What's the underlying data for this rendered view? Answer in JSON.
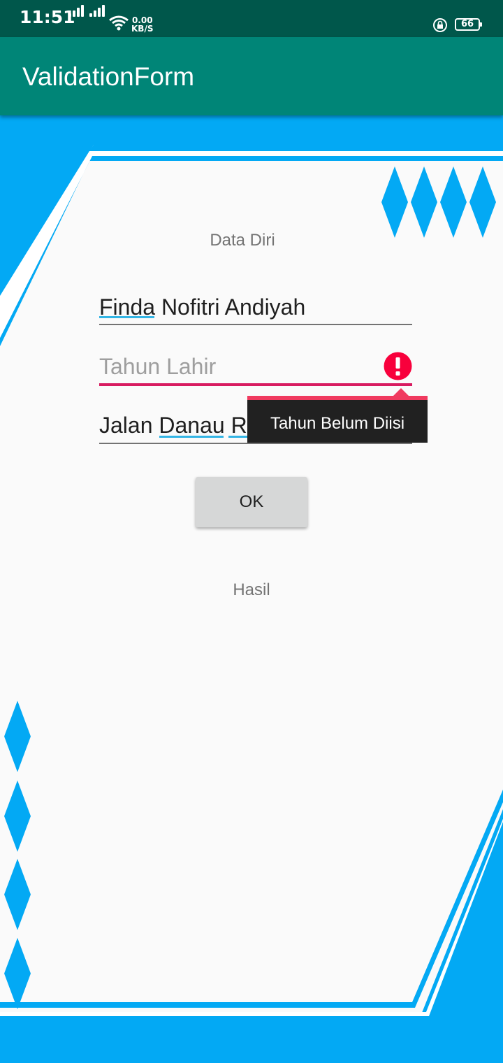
{
  "status_bar": {
    "time": "11:51",
    "net_speed_value": "0.00",
    "net_speed_unit": "KB/S",
    "battery_level": "66",
    "icons": [
      "signal-icon",
      "signal-icon",
      "wifi-icon",
      "lock-rotation-icon",
      "battery-icon"
    ]
  },
  "app_bar": {
    "title": "ValidationForm"
  },
  "form": {
    "header": "Data Diri",
    "nama_value": "Finda Nofitri Andiyah",
    "tahun_placeholder": "Tahun Lahir",
    "alamat_value": "Jalan Danau Ranau G1D8",
    "error_tooltip": "Tahun Belum Diisi",
    "ok_label": "OK",
    "result_label": "Hasil"
  },
  "colors": {
    "status_bar": "#00574B",
    "app_bar": "#008577",
    "decoration": "#03A9F4",
    "error": "#F8003C",
    "error_underline": "#D81B60"
  }
}
